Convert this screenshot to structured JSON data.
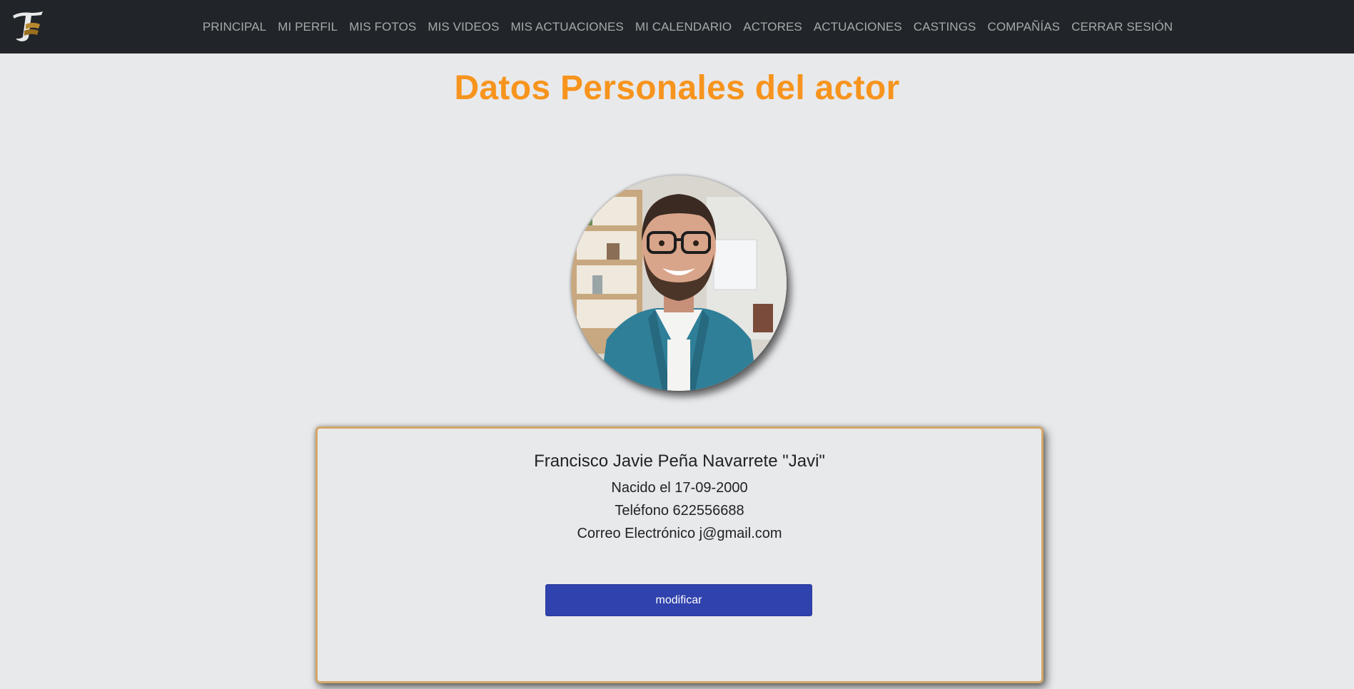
{
  "nav": {
    "logo_icon": "theatre-masks-logo-icon",
    "items": [
      {
        "label": "PRINCIPAL"
      },
      {
        "label": "MI PERFIL"
      },
      {
        "label": "MIS FOTOS"
      },
      {
        "label": "MIS VIDEOS"
      },
      {
        "label": "MIS ACTUACIONES"
      },
      {
        "label": "MI CALENDARIO"
      },
      {
        "label": "ACTORES"
      },
      {
        "label": "ACTUACIONES"
      },
      {
        "label": "CASTINGS"
      },
      {
        "label": "COMPAÑÍAS"
      },
      {
        "label": "CERRAR SESIÓN"
      }
    ]
  },
  "page": {
    "title": "Datos Personales del actor",
    "title_color": "#f7941d",
    "navbar_color": "#212529",
    "accent_button_color": "#3042ad",
    "card_border_color": "#d4a769"
  },
  "profile": {
    "photo_icon": "profile-photo-avatar",
    "name": "Francisco Javie Peña Navarrete \"Javi\"",
    "born": "Nacido el 17-09-2000",
    "phone": "Teléfono 622556688",
    "email": "Correo Electrónico j@gmail.com",
    "modify_label": "modificar"
  }
}
